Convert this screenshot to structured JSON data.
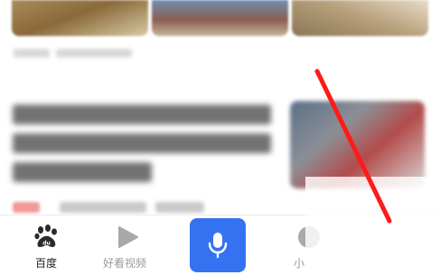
{
  "bottom_nav": {
    "items": [
      {
        "label": "百度",
        "icon": "baidu-paw-icon"
      },
      {
        "label": "好看视频",
        "icon": "play-triangle-icon"
      },
      {
        "label": "",
        "icon": "microphone-icon"
      },
      {
        "label": "小",
        "icon": "circle-icon"
      }
    ]
  },
  "colors": {
    "accent": "#3472f2",
    "annotation_red": "#ff1a1a",
    "nav_active_text": "#222222",
    "nav_inactive_text": "#9a9a9a"
  }
}
